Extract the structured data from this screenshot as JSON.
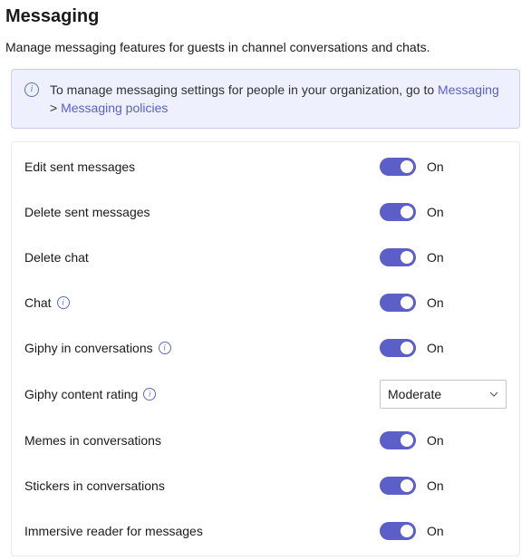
{
  "title": "Messaging",
  "description": "Manage messaging features for guests in channel conversations and chats.",
  "banner": {
    "prefix": "To manage messaging settings for people in your organization, go to ",
    "link1": "Messaging",
    "sep": " > ",
    "link2": "Messaging policies"
  },
  "toggle_text": {
    "on": "On"
  },
  "settings": {
    "edit_sent": {
      "label": "Edit sent messages",
      "value": "On"
    },
    "delete_sent": {
      "label": "Delete sent messages",
      "value": "On"
    },
    "delete_chat": {
      "label": "Delete chat",
      "value": "On"
    },
    "chat": {
      "label": "Chat",
      "value": "On"
    },
    "giphy": {
      "label": "Giphy in conversations",
      "value": "On"
    },
    "giphy_rating": {
      "label": "Giphy content rating",
      "value": "Moderate"
    },
    "memes": {
      "label": "Memes in conversations",
      "value": "On"
    },
    "stickers": {
      "label": "Stickers in conversations",
      "value": "On"
    },
    "immersive": {
      "label": "Immersive reader for messages",
      "value": "On"
    }
  }
}
